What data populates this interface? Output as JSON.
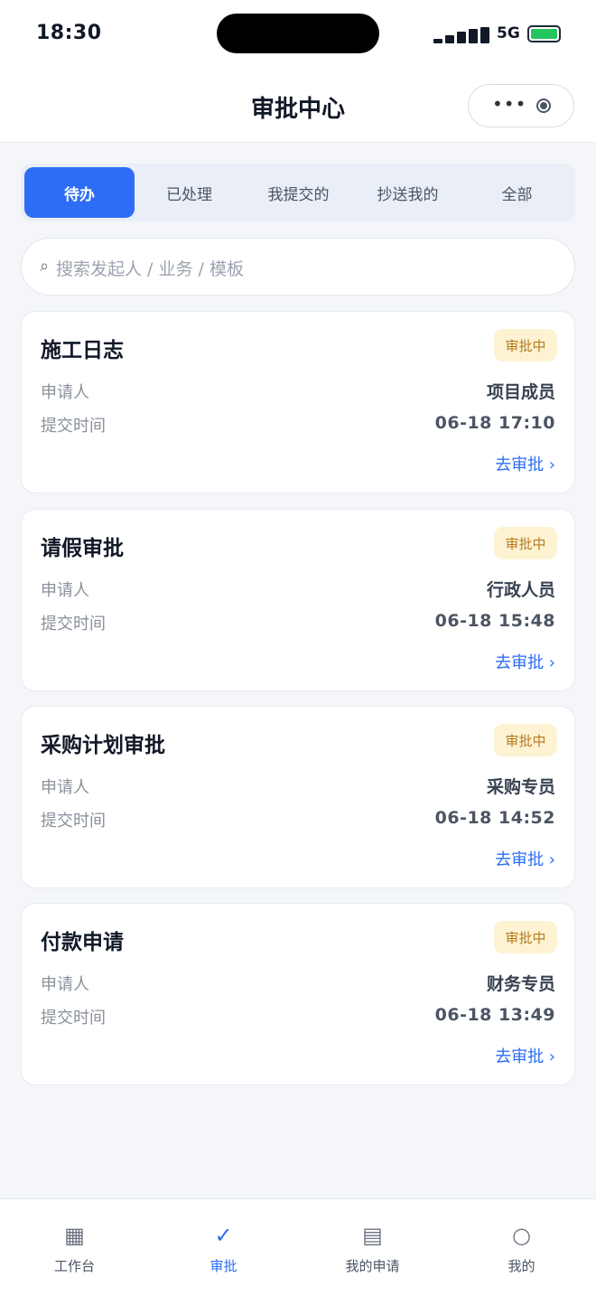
{
  "status_bar": {
    "time": "18:30",
    "network": "5G"
  },
  "nav": {
    "title": "审批中心",
    "more_glyph": "•••"
  },
  "tabs": [
    {
      "label": "待办",
      "active": true
    },
    {
      "label": "已处理",
      "active": false
    },
    {
      "label": "我提交的",
      "active": false
    },
    {
      "label": "抄送我的",
      "active": false
    },
    {
      "label": "全部",
      "active": false
    }
  ],
  "search": {
    "icon": "⌕",
    "placeholder": "搜索发起人 / 业务 / 模板"
  },
  "cards": [
    {
      "title": "施工日志",
      "status": "审批中",
      "applicant_label": "申请人",
      "applicant": "项目成员",
      "time_label": "提交时间",
      "time": "06-18 17:10",
      "action": "去审批 ›"
    },
    {
      "title": "请假审批",
      "status": "审批中",
      "applicant_label": "申请人",
      "applicant": "行政人员",
      "time_label": "提交时间",
      "time": "06-18 15:48",
      "action": "去审批 ›"
    },
    {
      "title": "采购计划审批",
      "status": "审批中",
      "applicant_label": "申请人",
      "applicant": "采购专员",
      "time_label": "提交时间",
      "time": "06-18 14:52",
      "action": "去审批 ›"
    },
    {
      "title": "付款申请",
      "status": "审批中",
      "applicant_label": "申请人",
      "applicant": "财务专员",
      "time_label": "提交时间",
      "time": "06-18 13:49",
      "action": "去审批 ›"
    }
  ],
  "tabbar": [
    {
      "label": "工作台",
      "icon": "▦",
      "active": false
    },
    {
      "label": "审批",
      "icon": "✓",
      "active": true
    },
    {
      "label": "我的申请",
      "icon": "▤",
      "active": false
    },
    {
      "label": "我的",
      "icon": "○",
      "active": false
    }
  ],
  "colors": {
    "accent": "#2d6df6",
    "badge_bg": "#fdf3d2",
    "badge_text": "#b7791f",
    "battery": "#22c55e"
  }
}
